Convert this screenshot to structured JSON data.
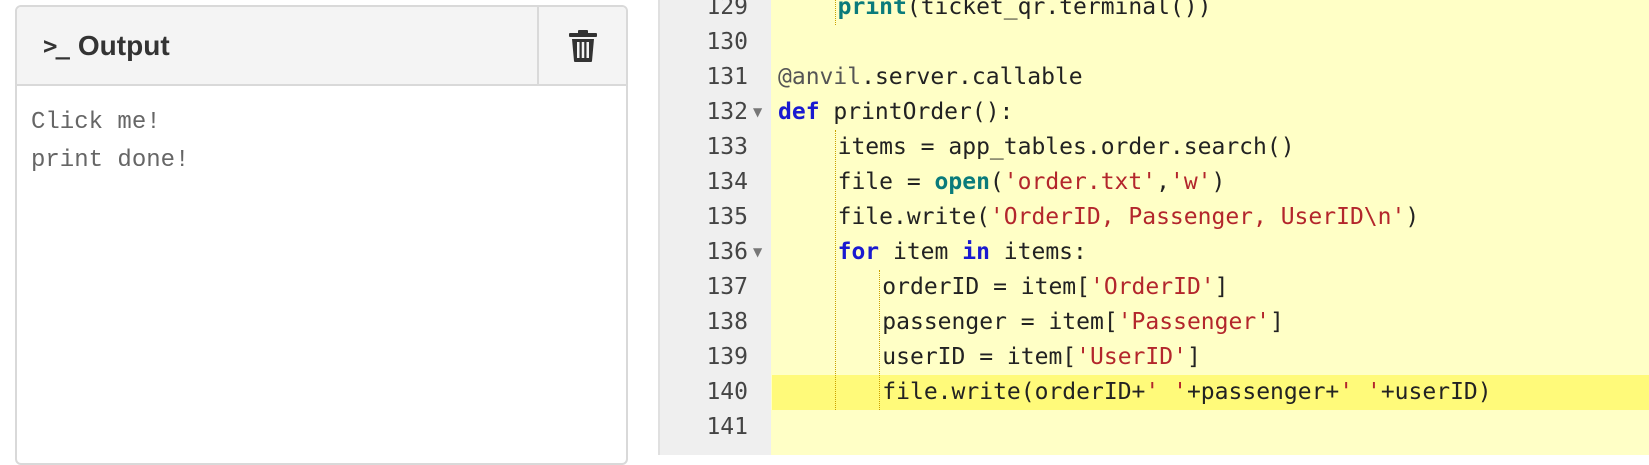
{
  "output": {
    "title": "Output",
    "terminal_glyph": ">_",
    "clear_icon": "trash-icon",
    "lines": [
      "Click me!",
      "print done!"
    ]
  },
  "editor": {
    "active_line": 140,
    "lines": [
      {
        "num": "129",
        "tokens": [
          {
            "t": "print",
            "c": "bi"
          },
          {
            "t": "(ticket_qr.terminal())",
            "c": ""
          }
        ]
      },
      {
        "num": "130",
        "tokens": []
      },
      {
        "num": "131",
        "tokens": [
          {
            "t": "@anvil",
            "c": "dec"
          },
          {
            "t": ".server.callable",
            "c": ""
          }
        ]
      },
      {
        "num": "132",
        "fold": true,
        "tokens": [
          {
            "t": "def",
            "c": "kw"
          },
          {
            "t": " printOrder():",
            "c": ""
          }
        ]
      },
      {
        "num": "133",
        "tokens": [
          {
            "t": "items = app_tables.order.search()",
            "c": ""
          }
        ]
      },
      {
        "num": "134",
        "tokens": [
          {
            "t": "file = ",
            "c": ""
          },
          {
            "t": "open",
            "c": "bi"
          },
          {
            "t": "(",
            "c": ""
          },
          {
            "t": "'order.txt'",
            "c": "str"
          },
          {
            "t": ",",
            "c": ""
          },
          {
            "t": "'w'",
            "c": "str"
          },
          {
            "t": ")",
            "c": ""
          }
        ]
      },
      {
        "num": "135",
        "tokens": [
          {
            "t": "file.write(",
            "c": ""
          },
          {
            "t": "'OrderID, Passenger, UserID\\n'",
            "c": "str"
          },
          {
            "t": ")",
            "c": ""
          }
        ]
      },
      {
        "num": "136",
        "fold": true,
        "tokens": [
          {
            "t": "for",
            "c": "kw"
          },
          {
            "t": " item ",
            "c": ""
          },
          {
            "t": "in",
            "c": "kw"
          },
          {
            "t": " items:",
            "c": ""
          }
        ]
      },
      {
        "num": "137",
        "tokens": [
          {
            "t": "orderID = item[",
            "c": ""
          },
          {
            "t": "'OrderID'",
            "c": "str"
          },
          {
            "t": "]",
            "c": ""
          }
        ]
      },
      {
        "num": "138",
        "tokens": [
          {
            "t": "passenger = item[",
            "c": ""
          },
          {
            "t": "'Passenger'",
            "c": "str"
          },
          {
            "t": "]",
            "c": ""
          }
        ]
      },
      {
        "num": "139",
        "tokens": [
          {
            "t": "userID = item[",
            "c": ""
          },
          {
            "t": "'UserID'",
            "c": "str"
          },
          {
            "t": "]",
            "c": ""
          }
        ]
      },
      {
        "num": "140",
        "tokens": [
          {
            "t": "file.write(orderID+",
            "c": ""
          },
          {
            "t": "' '",
            "c": "str"
          },
          {
            "t": "+passenger+",
            "c": ""
          },
          {
            "t": "' '",
            "c": "str"
          },
          {
            "t": "+userID)",
            "c": ""
          }
        ]
      },
      {
        "num": "141",
        "tokens": []
      }
    ]
  }
}
